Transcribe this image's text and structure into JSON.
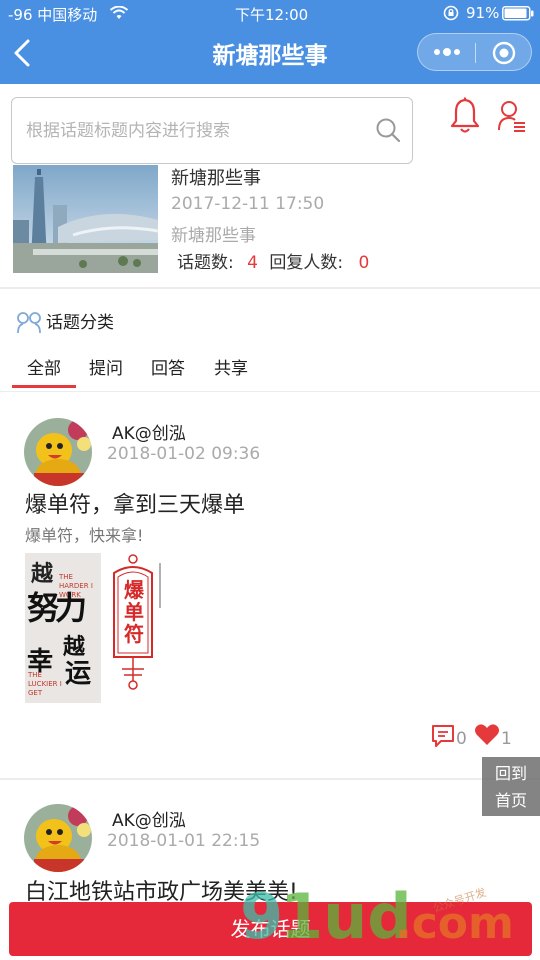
{
  "status_bar": {
    "signal": "-96 中国移动",
    "time": "下午12:00",
    "battery": "91%"
  },
  "nav": {
    "title": "新塘那些事",
    "back_icon": "back-arrow-icon",
    "menu_icon": "more-dots-icon",
    "close_icon": "target-circle-icon",
    "color": "#4a90e2"
  },
  "search": {
    "placeholder": "根据话题标题内容进行搜索",
    "value": ""
  },
  "header_icons": {
    "bell": "bell-icon",
    "user": "user-list-icon",
    "color": "#e5393c"
  },
  "topic_group": {
    "title": "新塘那些事",
    "date": "2017-12-11 17:50",
    "subtitle": "新塘那些事",
    "topic_count_label": "话题数:",
    "topic_count": "4",
    "reply_count_label": "回复人数:",
    "reply_count": "0"
  },
  "category": {
    "label": "话题分类",
    "tabs": [
      "全部",
      "提问",
      "回答",
      "共享"
    ],
    "active_tab": 0
  },
  "posts": [
    {
      "user": "AK@创泓",
      "time": "2018-01-02 09:36",
      "title": "爆单符，拿到三天爆单",
      "excerpt": "爆单符，快来拿!",
      "comments": "0",
      "likes": "1",
      "image1_text": {
        "line1": "越",
        "line2": "努力",
        "line3": "越",
        "line4": "幸",
        "line5": "运",
        "en1": "THE HARDER I WORK",
        "en2": "THE LUCKIER I GET"
      },
      "image2_text": "爆单符"
    },
    {
      "user": "AK@创泓",
      "time": "2018-01-01 22:15",
      "title": "白江地铁站市政广场美美美!"
    }
  ],
  "float_home": {
    "line1": "回到",
    "line2": "首页"
  },
  "publish_button": "发布话题",
  "watermark": {
    "text1": "9",
    "text2": "1ud",
    "text3": ".com",
    "text4": "公众号开发"
  }
}
